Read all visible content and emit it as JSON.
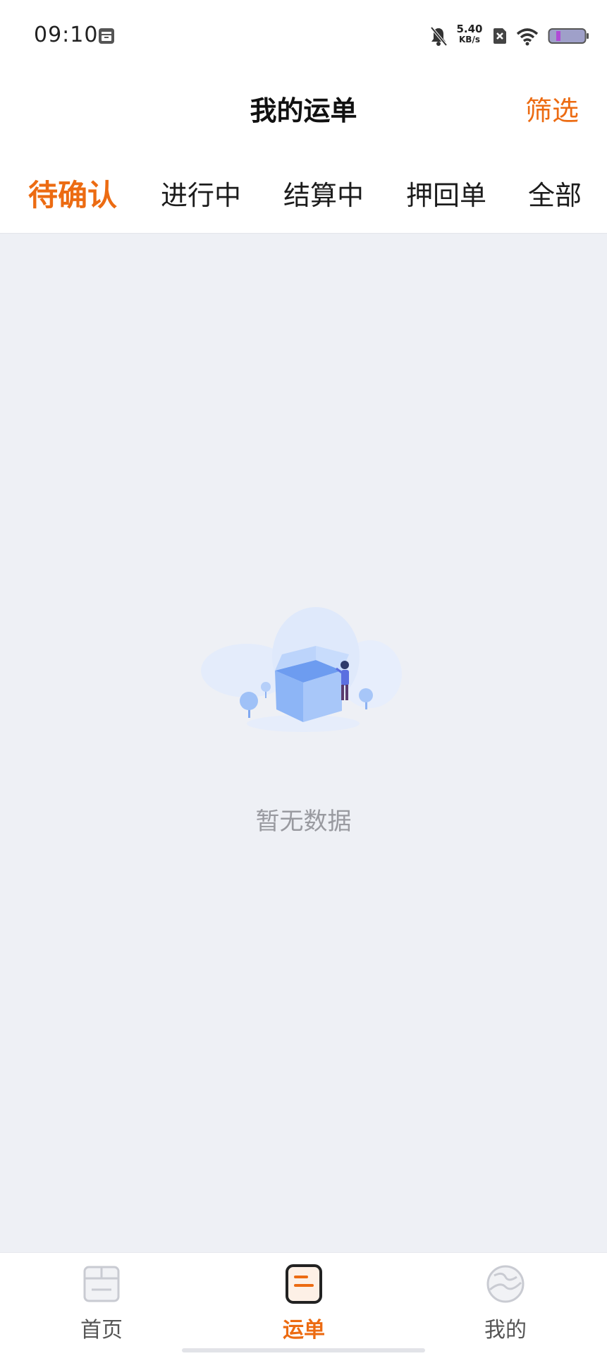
{
  "status_bar": {
    "time": "09:10",
    "net_speed_value": "5.40",
    "net_speed_unit": "KB/s"
  },
  "header": {
    "title": "我的运单",
    "filter_label": "筛选"
  },
  "tabs": [
    {
      "label": "待确认",
      "active": true
    },
    {
      "label": "进行中",
      "active": false
    },
    {
      "label": "结算中",
      "active": false
    },
    {
      "label": "押回单",
      "active": false
    },
    {
      "label": "全部",
      "active": false
    }
  ],
  "empty_state": {
    "message": "暂无数据"
  },
  "bottom_nav": [
    {
      "label": "首页",
      "icon": "home-box-icon",
      "active": false
    },
    {
      "label": "运单",
      "icon": "waybill-icon",
      "active": true
    },
    {
      "label": "我的",
      "icon": "profile-planet-icon",
      "active": false
    }
  ],
  "colors": {
    "accent": "#ec6b12",
    "background": "#eef0f5",
    "text_muted": "#999aa0"
  }
}
